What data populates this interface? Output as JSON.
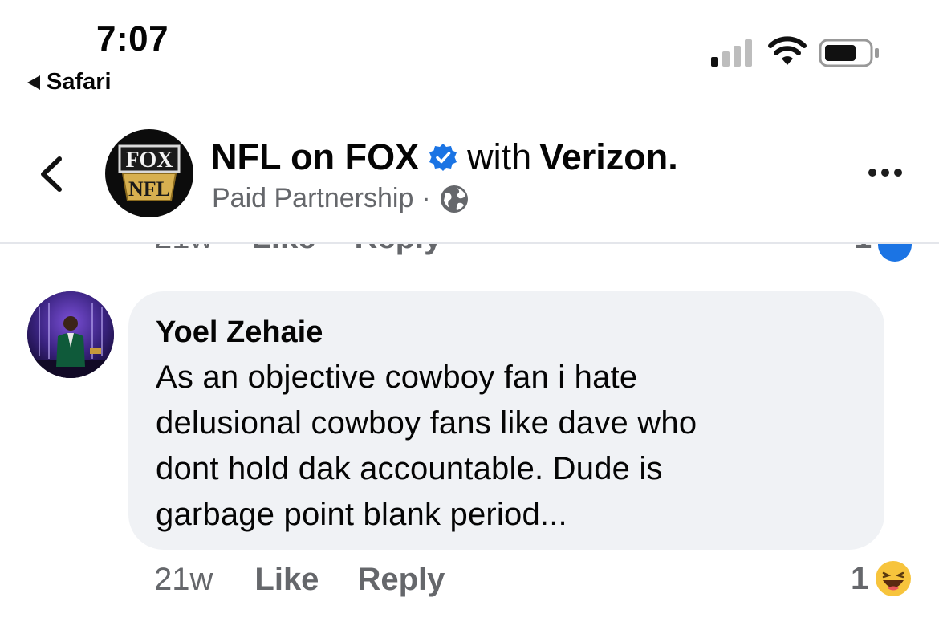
{
  "status_bar": {
    "time": "7:07",
    "back_app": "Safari",
    "icons": [
      "signal-icon",
      "wifi-icon",
      "battery-icon"
    ]
  },
  "header": {
    "back_icon": "chevron-left-icon",
    "avatar_logo_top": "FOX",
    "avatar_logo_bottom": "NFL",
    "page_name": "NFL on FOX",
    "verified_icon": "verified-badge-icon",
    "with_text": "with",
    "partner": "Verizon.",
    "subtitle": "Paid Partnership",
    "separator": "·",
    "audience_icon": "globe-icon",
    "more_icon": "more-options-icon"
  },
  "previous_comment": {
    "time": "21w",
    "like": "Like",
    "reply": "Reply",
    "reaction_count": "1"
  },
  "comment": {
    "author": "Yoel Zehaie",
    "text_lines": [
      "As an objective cowboy fan i hate",
      "delusional cowboy fans like dave who",
      "dont hold dak accountable. Dude is",
      "garbage point blank period..."
    ],
    "time": "21w",
    "like": "Like",
    "reply": "Reply",
    "reaction_count": "1",
    "reaction_icon": "haha-emoji-icon"
  },
  "colors": {
    "text": "#050505",
    "secondary": "#65676b",
    "bubble": "#f0f2f5",
    "verified": "#1b74e4"
  }
}
